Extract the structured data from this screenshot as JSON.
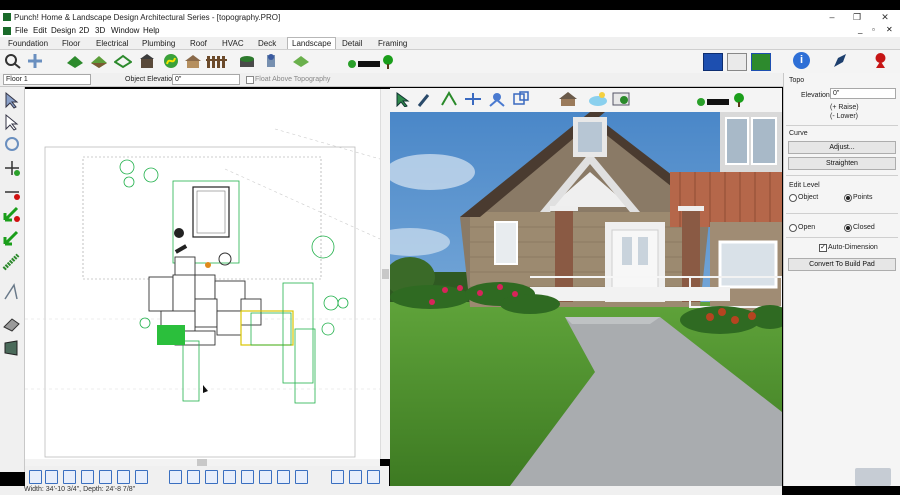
{
  "window": {
    "title": "Punch! Home & Landscape Design Architectural Series - [topography.PRO]",
    "minimize": "–",
    "maximize": "❐",
    "close": "✕",
    "doc_minimize": "_",
    "doc_restore": "▫",
    "doc_close": "✕"
  },
  "menu": [
    "File",
    "Edit",
    "Design",
    "2D",
    "3D",
    "Window",
    "Help"
  ],
  "tabs": [
    "Foundation",
    "Floor",
    "Electrical",
    "Plumbing",
    "Roof",
    "HVAC",
    "Deck",
    "Landscape",
    "Detail",
    "Framing"
  ],
  "active_tab": "Landscape",
  "options": {
    "floor_select": "Floor 1",
    "elevation_label": "Object Elevation:",
    "elevation_value": "0\"",
    "float_label": "Float Above Topography"
  },
  "right_panel": {
    "topo_heading": "Topo",
    "elevation_label": "Elevation:",
    "elevation_value": "0\"",
    "raise_hint": "(+ Raise)",
    "lower_hint": "(- Lower)",
    "curve_heading": "Curve",
    "adjust_button": "Adjust...",
    "straighten_button": "Straighten",
    "edit_level_heading": "Edit Level",
    "object_option": "Object",
    "points_option": "Points",
    "open_option": "Open",
    "closed_option": "Closed",
    "auto_dimension": "Auto-Dimension",
    "convert_button": "Convert To Build Pad"
  },
  "status": {
    "dimensions": "Width: 34'-10 3/4\", Depth: 24'-8 7/8\""
  },
  "colors": {
    "accent_blue": "#2e6fd6",
    "plan_green": "#22b14c",
    "grass": "#4e8f2f",
    "brick": "#8a5a44"
  }
}
